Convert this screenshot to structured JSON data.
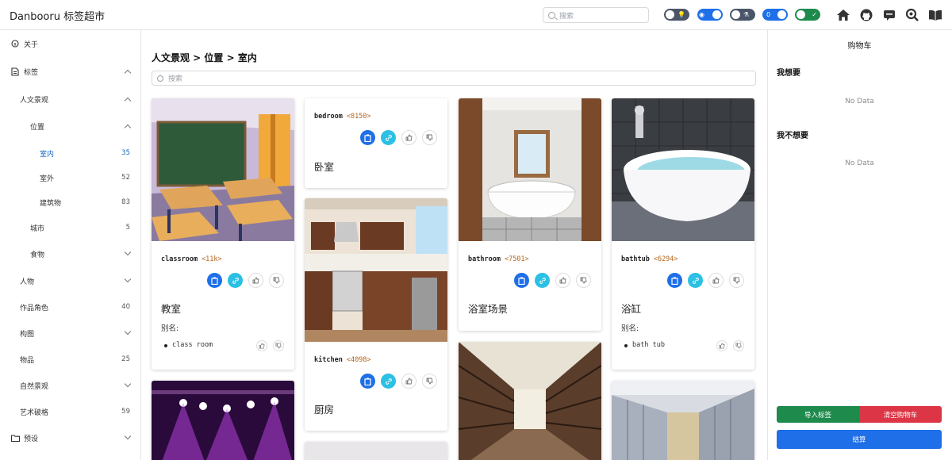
{
  "header": {
    "title": "Danbooru 标签超市",
    "search_placeholder": "搜索",
    "toggles": [
      {
        "name": "theme-toggle",
        "on": false,
        "color": "#4a5568",
        "icon": "bulb-icon"
      },
      {
        "name": "eye-toggle",
        "on": true,
        "color": "#1e6fe8",
        "icon": "eye-icon"
      },
      {
        "name": "nsfw-toggle",
        "on": false,
        "color": "#4a5568",
        "icon": "flask-icon"
      },
      {
        "name": "count-toggle",
        "on": true,
        "color": "#1e6fe8",
        "text": "0"
      },
      {
        "name": "check-toggle",
        "on": true,
        "color": "#1e8a4c",
        "icon": "check-icon"
      }
    ]
  },
  "sidebar": {
    "about": "关于",
    "tags": "标签",
    "humanities": "人文景观",
    "location": "位置",
    "indoor": {
      "label": "室内",
      "count": "35"
    },
    "outdoor": {
      "label": "室外",
      "count": "52"
    },
    "building": {
      "label": "建筑物",
      "count": "83"
    },
    "city": {
      "label": "城市",
      "count": "5"
    },
    "food": "食物",
    "people": "人物",
    "characters": {
      "label": "作品角色",
      "count": "40"
    },
    "composition": "构图",
    "objects": {
      "label": "物品",
      "count": "25"
    },
    "nature": "自然景观",
    "art": {
      "label": "艺术破格",
      "count": "59"
    },
    "presets": "预设"
  },
  "main": {
    "breadcrumb": "人文景观 > 位置 > 室内",
    "search_placeholder": "搜索",
    "cards": [
      {
        "tag": "classroom",
        "count": "<11k>",
        "zh": "教室",
        "alias_label": "别名:",
        "aliases": [
          "class room"
        ]
      },
      {
        "tag": "bedroom",
        "count": "<8150>",
        "zh": "卧室"
      },
      {
        "tag": "kitchen",
        "count": "<4098>",
        "zh": "厨房"
      },
      {
        "tag": "bathroom",
        "count": "<7501>",
        "zh": "浴室场景"
      },
      {
        "tag": "bathtub",
        "count": "<6294>",
        "zh": "浴缸",
        "alias_label": "别名:",
        "aliases": [
          "bath tub"
        ]
      }
    ]
  },
  "cart": {
    "title": "购物车",
    "want": "我想要",
    "not_want": "我不想要",
    "no_data": "No Data",
    "import_btn": "导入标签",
    "clear_btn": "清空购物车",
    "checkout_btn": "结算",
    "colors": {
      "import": "#1e8a4c",
      "clear": "#dc3545",
      "checkout": "#1e6fe8"
    }
  }
}
